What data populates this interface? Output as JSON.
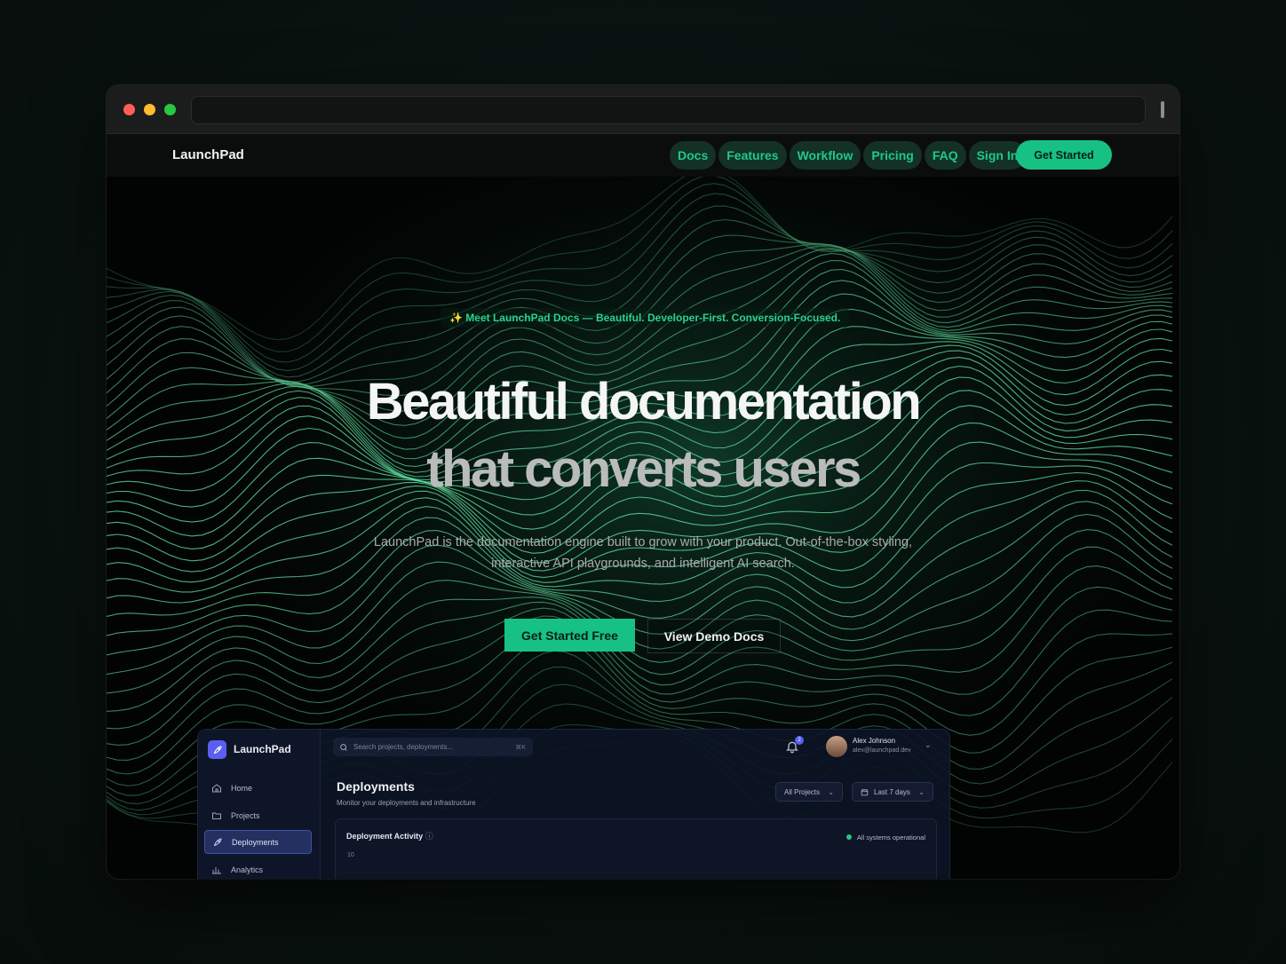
{
  "nav": {
    "brand": "LaunchPad",
    "links": [
      "Docs",
      "Features",
      "Workflow",
      "Pricing",
      "FAQ",
      "Sign In"
    ],
    "cta": "Get Started"
  },
  "hero": {
    "badge": "✨ Meet LaunchPad Docs — Beautiful. Developer-First. Conversion-Focused.",
    "title_line1": "Beautiful documentation",
    "title_line2": "that converts users",
    "subtitle": "LaunchPad is the documentation engine built to grow with your product. Out-of-the-box styling, interactive API playgrounds, and intelligent AI search.",
    "primary_button": "Get Started Free",
    "secondary_button": "View Demo Docs"
  },
  "dashboard": {
    "brand": "LaunchPad",
    "search_placeholder": "Search projects, deployments...",
    "search_shortcut": "⌘K",
    "notification_count": "2",
    "user_name": "Alex Johnson",
    "user_email": "alex@launchpad.dev",
    "sidebar": [
      {
        "label": "Home",
        "icon": "home-icon",
        "active": false
      },
      {
        "label": "Projects",
        "icon": "folder-icon",
        "active": false
      },
      {
        "label": "Deployments",
        "icon": "rocket-icon",
        "active": true
      },
      {
        "label": "Analytics",
        "icon": "bar-chart-icon",
        "active": false
      }
    ],
    "page_title": "Deployments",
    "page_subtitle": "Monitor your deployments and infrastructure",
    "filter_projects": "All Projects",
    "filter_range": "Last 7 days",
    "card_title": "Deployment Activity",
    "status_text": "All systems operational",
    "y_tick": "10"
  },
  "colors": {
    "accent": "#17c184",
    "accent_text": "#20c98a",
    "nav_pill_bg": "#143126",
    "window_bg": "#050606",
    "dashboard_accent": "#5b5ff0"
  }
}
